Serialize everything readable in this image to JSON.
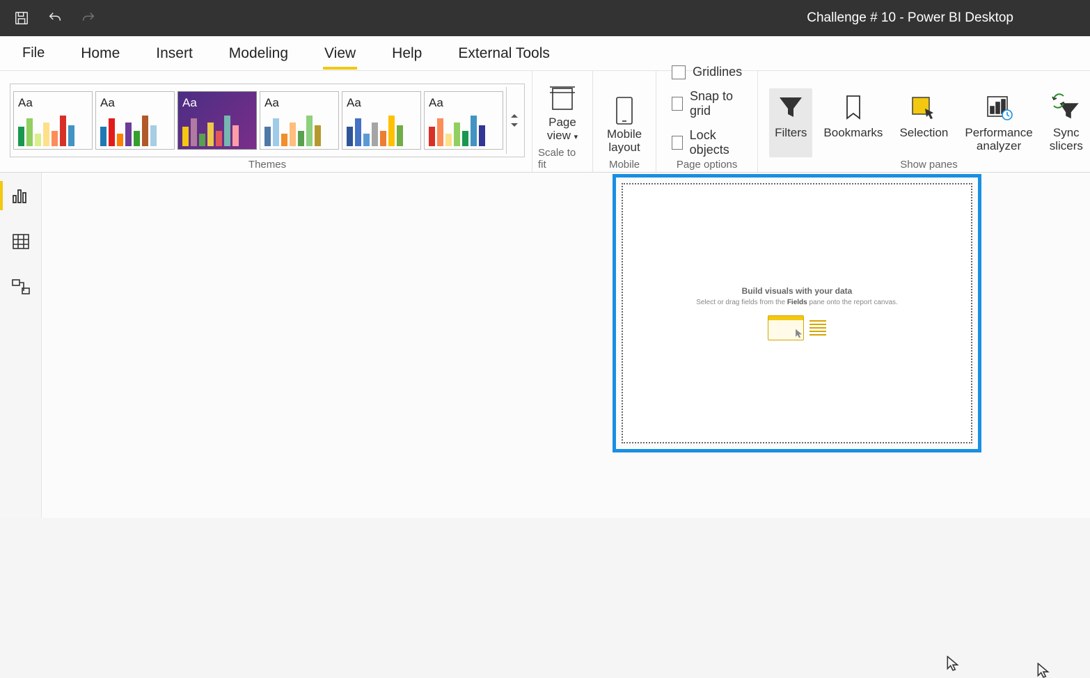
{
  "title": "Challenge # 10 - Power BI Desktop",
  "menu": {
    "file": "File",
    "home": "Home",
    "insert": "Insert",
    "modeling": "Modeling",
    "view": "View",
    "help": "Help",
    "external": "External Tools"
  },
  "ribbon": {
    "themes_label": "Themes",
    "theme_sample_text": "Aa",
    "scale": {
      "label": "Scale to fit",
      "page_view": "Page\nview"
    },
    "mobile": {
      "group": "Mobile",
      "layout": "Mobile\nlayout"
    },
    "page_options": {
      "group": "Page options",
      "gridlines": "Gridlines",
      "snap": "Snap to grid",
      "lock": "Lock objects"
    },
    "show_panes": {
      "group": "Show panes",
      "filters": "Filters",
      "bookmarks": "Bookmarks",
      "selection": "Selection",
      "performance": "Performance\nanalyzer",
      "sync": "Sync\nslicers"
    }
  },
  "canvas_placeholder": {
    "title": "Build visuals with your data",
    "sub_pre": "Select or drag fields from the ",
    "sub_bold": "Fields",
    "sub_post": " pane onto the report canvas."
  },
  "theme_palettes": [
    [
      "#1a9850",
      "#91cf60",
      "#d9ef8b",
      "#fee08b",
      "#fc8d59",
      "#d73027",
      "#4393c3"
    ],
    [
      "#1f78b4",
      "#e31a1c",
      "#ff7f00",
      "#6a3d9a",
      "#33a02c",
      "#b15928",
      "#a6cee3"
    ],
    [
      "#f2c811",
      "#b07aa1",
      "#59a14f",
      "#edc948",
      "#e15759",
      "#76b7b2",
      "#ff9da7"
    ],
    [
      "#4e79a7",
      "#a0cbe8",
      "#f28e2b",
      "#ffbe7d",
      "#59a14f",
      "#8cd17d",
      "#b6992d"
    ],
    [
      "#2f5597",
      "#4472c4",
      "#5b9bd5",
      "#a5a5a5",
      "#ed7d31",
      "#ffc000",
      "#70ad47"
    ],
    [
      "#d73027",
      "#fc8d59",
      "#fee08b",
      "#91cf60",
      "#1a9850",
      "#4393c3",
      "#313695"
    ]
  ]
}
